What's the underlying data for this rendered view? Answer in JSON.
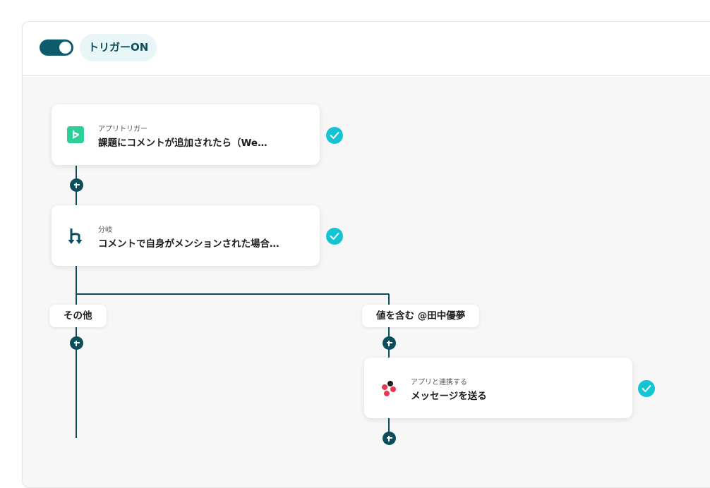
{
  "header": {
    "trigger_status": "トリガーON",
    "toggle_on": true
  },
  "flow": {
    "steps": [
      {
        "kicker": "アプリトリガー",
        "title": "課題にコメントが追加されたら（We…",
        "icon": "backlog-logo-icon",
        "brand_color": "#2ccf97",
        "completed": true
      },
      {
        "kicker": "分岐",
        "title": "コメントで自身がメンションされた場合…",
        "icon": "branch-icon",
        "brand_color": "#0d4e5e",
        "completed": true
      },
      {
        "kicker": "アプリと連携する",
        "title": "メッセージを送る",
        "icon": "chatwork-logo-icon",
        "brand_color": "#e8384f",
        "completed": true
      }
    ],
    "branches": [
      {
        "label": "その他"
      },
      {
        "label": "値を含む @田中優夢"
      }
    ]
  },
  "colors": {
    "accent": "#0d4e5e",
    "check": "#15c4d3",
    "canvas": "#f7f7f7"
  }
}
